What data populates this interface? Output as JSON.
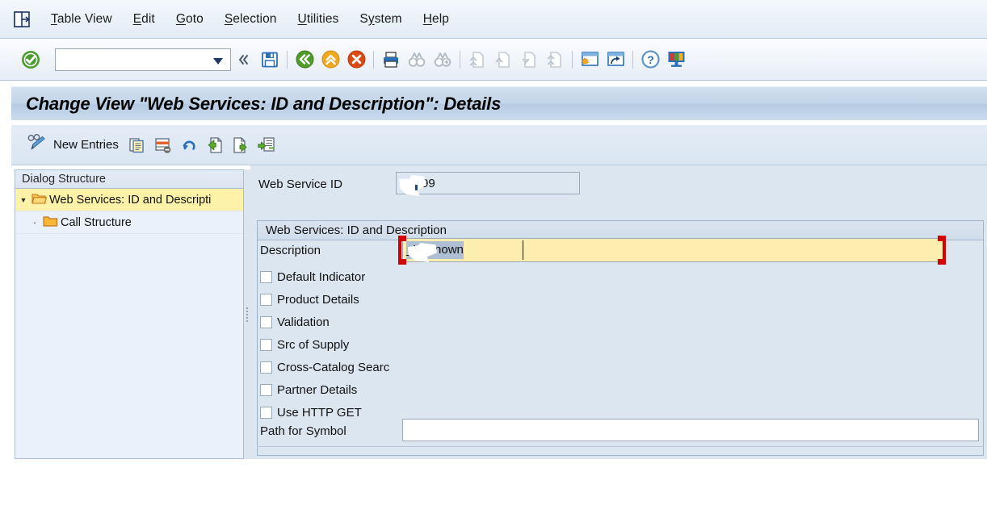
{
  "window": {
    "title": "Change View \"Web Services: ID and Description\": Details"
  },
  "menubar": {
    "logo_icon": "sap-session-icon",
    "items": [
      {
        "label": "Table View",
        "accel": "T",
        "name": "menu-table-view"
      },
      {
        "label": "Edit",
        "accel": "E",
        "name": "menu-edit"
      },
      {
        "label": "Goto",
        "accel": "G",
        "name": "menu-goto"
      },
      {
        "label": "Selection",
        "accel": "S",
        "name": "menu-selection"
      },
      {
        "label": "Utilities",
        "accel": "U",
        "name": "menu-utilities"
      },
      {
        "label": "System",
        "accel": "y",
        "name": "menu-system"
      },
      {
        "label": "Help",
        "accel": "H",
        "name": "menu-help"
      }
    ]
  },
  "toolbar": {
    "enter_icon": "green-check-enter-icon",
    "okcode": {
      "value": "",
      "placeholder": ""
    },
    "dropdown_icon": "chevron-down-icon",
    "collapse_icon": "double-chevron-left-icon",
    "buttons": [
      {
        "name": "save-button",
        "icon": "save-floppy-icon",
        "enabled": true
      },
      {
        "name": "back-button",
        "icon": "green-back-arrow-icon",
        "enabled": true
      },
      {
        "name": "exit-button",
        "icon": "orange-exit-up-icon",
        "enabled": true
      },
      {
        "name": "cancel-button",
        "icon": "red-cancel-icon",
        "enabled": true
      },
      {
        "name": "print-button",
        "icon": "printer-icon",
        "enabled": true
      },
      {
        "name": "find-button",
        "icon": "binoculars-icon",
        "enabled": false
      },
      {
        "name": "find-next-button",
        "icon": "binoculars-plus-icon",
        "enabled": false
      },
      {
        "name": "first-page-button",
        "icon": "first-page-icon",
        "enabled": false
      },
      {
        "name": "previous-page-button",
        "icon": "previous-page-icon",
        "enabled": false
      },
      {
        "name": "next-page-button",
        "icon": "next-page-icon",
        "enabled": false
      },
      {
        "name": "last-page-button",
        "icon": "last-page-icon",
        "enabled": false
      },
      {
        "name": "create-session-button",
        "icon": "new-session-icon",
        "enabled": true
      },
      {
        "name": "create-shortcut-button",
        "icon": "shortcut-icon",
        "enabled": true
      },
      {
        "name": "help-button",
        "icon": "question-help-icon",
        "enabled": true
      },
      {
        "name": "customize-layout-button",
        "icon": "layout-menu-icon",
        "enabled": true
      }
    ]
  },
  "app_toolbar": {
    "new_entries_icon": "glasses-pencil-icon",
    "new_entries_label": "New Entries",
    "buttons": [
      {
        "name": "copy-as-button",
        "icon": "copy-document-icon"
      },
      {
        "name": "delete-button",
        "icon": "delete-row-icon"
      },
      {
        "name": "undo-button",
        "icon": "undo-arrow-icon"
      },
      {
        "name": "previous-entry-button",
        "icon": "previous-entry-icon"
      },
      {
        "name": "next-entry-button",
        "icon": "next-entry-icon"
      },
      {
        "name": "other-entry-button",
        "icon": "other-entry-icon"
      }
    ]
  },
  "tree": {
    "header": "Dialog Structure",
    "nodes": [
      {
        "label": "Web Services: ID and Descripti",
        "selected": true,
        "expanded": true,
        "level": 0,
        "icon": "open-folder-icon"
      },
      {
        "label": "Call Structure",
        "selected": false,
        "expanded": false,
        "level": 1,
        "icon": "closed-folder-icon"
      }
    ]
  },
  "form": {
    "ws_id": {
      "label": "Web Service ID",
      "value": "_9999",
      "redacted": true
    },
    "group": {
      "title": "Web Services: ID and Description"
    },
    "description": {
      "label": "Description",
      "value": "_Unknown",
      "redacted": true,
      "focused": true,
      "selected": true
    },
    "checkboxes": [
      {
        "label": "Default Indicator",
        "checked": false,
        "name": "checkbox-default-indicator"
      },
      {
        "label": "Product Details",
        "checked": false,
        "name": "checkbox-product-details"
      },
      {
        "label": "Validation",
        "checked": false,
        "name": "checkbox-validation"
      },
      {
        "label": "Src of Supply",
        "checked": false,
        "name": "checkbox-src-of-supply"
      },
      {
        "label": "Cross-Catalog Searc",
        "checked": false,
        "name": "checkbox-cross-catalog-search"
      },
      {
        "label": "Partner Details",
        "checked": false,
        "name": "checkbox-partner-details"
      },
      {
        "label": "Use HTTP GET",
        "checked": false,
        "name": "checkbox-use-http-get"
      }
    ],
    "path_symbol": {
      "label": "Path for Symbol",
      "value": "",
      "placeholder": ""
    }
  },
  "colors": {
    "focus_bracket": "#d40000",
    "focused_field": "#fdeeb0",
    "tree_selected": "#fdf2a8",
    "form_background": "#dce6f0",
    "tree_background": "#eaf1fa",
    "title_bar": "#c3d5e9"
  }
}
